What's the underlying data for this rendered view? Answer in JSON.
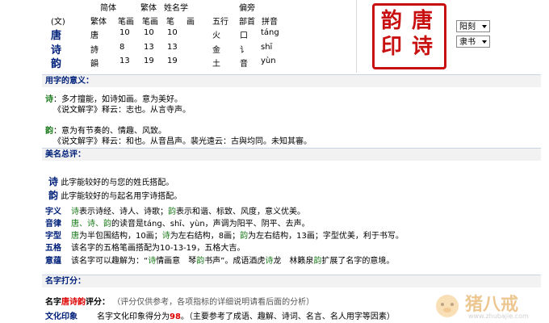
{
  "top_table": {
    "group_labels": {
      "jianti": "简体",
      "fanti": "繁体",
      "xingming": "姓名学",
      "pianpang": "偏旁"
    },
    "headers": [
      "(文)",
      "繁体",
      "笔画",
      "笔画",
      "笔",
      "画",
      "五行",
      "部首",
      "拼音"
    ],
    "rows": [
      {
        "char": "唐",
        "fanti": "唐",
        "jianti_bihua": "10",
        "fanti_bihua": "10",
        "xingming_bihua": "10",
        "wuxing": "火",
        "bushou": "口",
        "pinyin": "táng"
      },
      {
        "char": "诗",
        "fanti": "詩",
        "jianti_bihua": "8",
        "fanti_bihua": "13",
        "xingming_bihua": "13",
        "wuxing": "金",
        "bushou": "讠",
        "pinyin": "shī"
      },
      {
        "char": "韵",
        "fanti": "韻",
        "jianti_bihua": "13",
        "fanti_bihua": "19",
        "xingming_bihua": "19",
        "wuxing": "土",
        "bushou": "音",
        "pinyin": "yùn"
      }
    ]
  },
  "seal": {
    "chars": [
      "唐",
      "诗",
      "韵",
      "印"
    ],
    "color": "#c81010"
  },
  "selects": {
    "style": "阳刻",
    "font": "隶书"
  },
  "section_meaning": {
    "title": "用字的意义：",
    "entries": [
      {
        "char": "诗",
        "line1": "：多才擅能，如诗如画。意为美好。",
        "line2": "《说文解字》释云：志也。从言寺声。"
      },
      {
        "char": "韵",
        "line1": "：意为有节奏的、情趣、风致。",
        "line2": "《说文解字》释云：和也。从音昌声。裴光遠云：古與均同。未知其審。"
      }
    ]
  },
  "section_review": {
    "title": "美名总评：",
    "pairing": [
      {
        "char": "诗",
        "text": "此字能较好的与您的姓氏搭配。"
      },
      {
        "char": "韵",
        "text": "此字能较好的与起名用字诗搭配。"
      }
    ],
    "items": [
      {
        "label": "字义",
        "p1": "诗",
        "t1": "表示诗经、诗人、诗歌；",
        "p2": "韵",
        "t2": "表示和谐、标致、风度，意义优美。"
      },
      {
        "label": "音律",
        "p1": "唐、诗、韵",
        "t1": "的读音是táng、shī、yùn，声调为阳平、阴平、去声。"
      },
      {
        "label": "字型",
        "p1": "唐",
        "t1": "为半包围结构，10画；",
        "p2": "诗",
        "t2": "为左右结构，8画；",
        "p3": "韵",
        "t3": "为左右结构，13画；字型优美，利于书写。"
      },
      {
        "label": "五格",
        "t1": "该名字的五格笔画搭配为10-13-19，五格大吉。"
      },
      {
        "label": "意蕴",
        "t1": "该名字可以趣解为：“",
        "p1": "诗",
        "t2": "情画意　琴",
        "p2": "韵",
        "t3": "书声”。成语酒虎",
        "p3": "诗",
        "t4": "龙　林籁泉",
        "p4": "韵",
        "t5": "扩展了名字的意境。"
      }
    ]
  },
  "section_score": {
    "title": "名字打分：",
    "score_label_prefix": "名字",
    "name": "唐诗韵",
    "score_label_suffix": "评分：",
    "score_note": "（评分仅供参考，各项指标的详细说明请看后面的分析）",
    "culture_label": "文化印象",
    "culture_text_pre": "名字文化印象得分为",
    "culture_score": "98",
    "culture_text_post": "。（主要参考了成语、趣解、诗词、名言、名人用字等因素）"
  },
  "watermark": {
    "text": "猪八戒",
    "url": "www.zhubajie.com"
  }
}
